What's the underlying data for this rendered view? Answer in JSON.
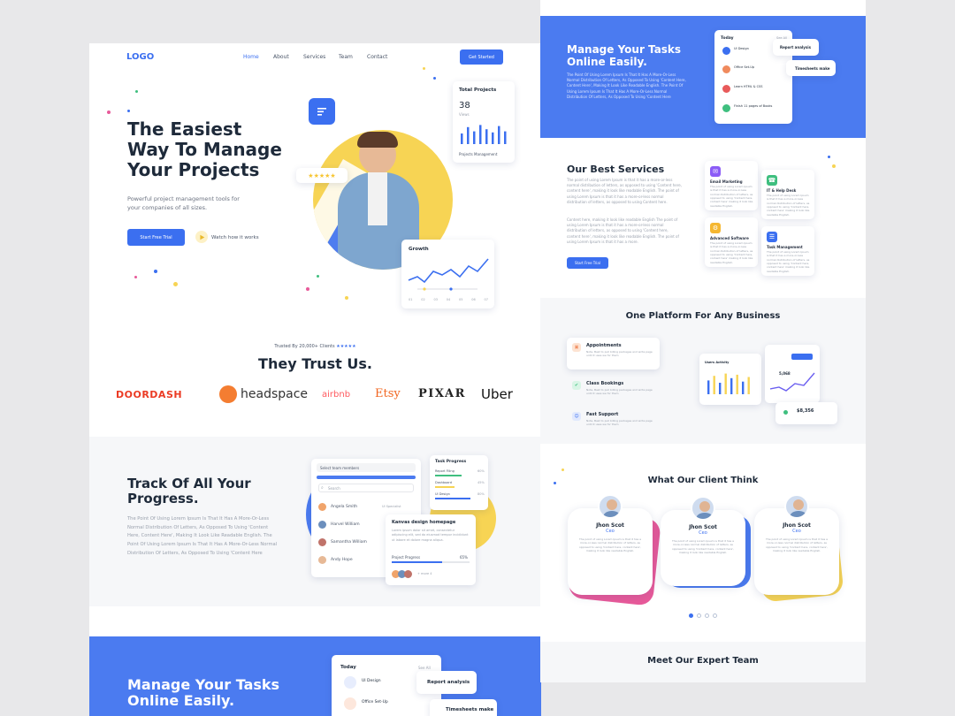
{
  "left": {
    "logo": "LOGO",
    "nav": [
      "Home",
      "About",
      "Services",
      "Team",
      "Contact"
    ],
    "cta": "Get Started",
    "hero": {
      "title_lines": [
        "The  Easiest",
        "Way To Manage",
        "Your  Projects"
      ],
      "subtitle_lines": [
        "Powerful project management tools for",
        "your companies of all sizes."
      ],
      "primary_btn": "Start Free Trial",
      "secondary_btn": "Watch how it works",
      "stars": "★★★★★"
    },
    "total_projects": {
      "title": "Total Projects",
      "value": "38",
      "label": "Views",
      "footer": "Projects Management",
      "bars": [
        0.5,
        0.8,
        0.6,
        0.9,
        0.7,
        0.55,
        0.85,
        0.6
      ]
    },
    "growth": {
      "title": "Growth",
      "axis": [
        "01",
        "02",
        "03",
        "04",
        "05",
        "06",
        "07"
      ]
    },
    "trust": {
      "caption": "Trusted By 20,000+ Clients",
      "stars": "★★★★★",
      "title": "They Trust Us."
    },
    "brands": [
      "DOORDASH",
      "headspace",
      "airbnb",
      "Etsy",
      "PIXAR",
      "Uber"
    ],
    "progress": {
      "title_lines": [
        "Track Of All Your",
        "Progress."
      ],
      "body": "The Point Of Using Lorem Ipsum Is That It Has A More-Or-Less Normal Distribution Of Letters, As Opposed To Using 'Content Here, Content Here', Making It Look Like Readable English. The Point Of Using Lorem Ipsum Is That It Has A More-Or-Less Normal Distribution Of Letters, As Opposed To Using 'Content Here",
      "select_label": "Select team members",
      "search": "Search",
      "members": [
        "Angela Smith",
        "Harvel William",
        "Samantha William",
        "Andy Hope"
      ],
      "member_role": "UI Specialist",
      "task_progress": "Task Progress",
      "task_rows": [
        "Report Filing",
        "Dashboard",
        "UI Design"
      ],
      "task_pcts": [
        "60%",
        "45%",
        "80%"
      ],
      "task_card_title": "Kanvas design homepage",
      "task_card_sub": "Project Progress",
      "task_pct": "65%",
      "members_more": "+ more 4"
    },
    "bottom": {
      "title_lines": [
        "Manage Your Tasks",
        "Online Easily."
      ],
      "today": "Today",
      "see_all": "See All",
      "items": [
        "UI Design",
        "Office Set-Up"
      ],
      "chips": [
        "Report analysis",
        "Timesheets make"
      ]
    }
  },
  "right": {
    "manage": {
      "title_lines": [
        "Manage Your Tasks",
        "Online Easily."
      ],
      "body": "The Point Of Using Lorem Ipsum Is That It Has A More-Or-Less Normal Distribution Of Letters, As Opposed To Using 'Content Here, Content Here', Making It Look Like Readable English. The Point Of Using Lorem Ipsum Is That It Has A More-Or-Less Normal Distribution Of Letters, As Opposed To Using 'Content Here",
      "today": "Today",
      "see_all": "See All",
      "items": [
        "UI Design",
        "Office Set-Up",
        "Learn HTML & CSS",
        "Finish 11 pages of Books"
      ],
      "chips": [
        "Report analysis",
        "Timesheets make"
      ]
    },
    "services": {
      "title": "Our Best Services",
      "body1": "The point of using Lorem Ipsum is that it has a more-or-less normal distribution of letters, as opposed to using 'Content here, content here', making it look like readable English. The point of using Lorem Ipsum is that it has a more-or-less normal distribution of letters, as opposed to using Content here.",
      "body2": "Content here, making it look like readable English The point of using Lorem Ipsum is that it has a more-or-less normal distribution of letters, as opposed to using 'Content here, content here', making it look like readable English. The point of using Lorem Ipsum is that it has a more.",
      "btn": "Start Free Trial",
      "cards": [
        "Email Marketing",
        "IT & Help Desk",
        "Advanced Software",
        "Task Management"
      ],
      "card_text": "The point of using Lorem Ipsum is that it has a more-or-less normal distribution of letters, as opposed to using 'Content here, content here' making it look like readable English."
    },
    "platform": {
      "title": "One Platform For Any Business",
      "features": [
        "Appointments",
        "Class Bookings",
        "Fast Support"
      ],
      "feature_text": "Note, Best to pull billing packages and write page until it uses we for them",
      "users_activity": "Users Activity",
      "stat1": "5,068",
      "stat2": "$8,356"
    },
    "clients": {
      "title": "What Our Client Think",
      "cards": [
        {
          "name": "Jhon Scot",
          "role": "Ceo"
        },
        {
          "name": "Jhon Scot",
          "role": "Ceo"
        },
        {
          "name": "Jhon Scot",
          "role": "Ceo"
        }
      ],
      "quote": "The point of using Lorem Ipsum is that it has a more-or-less normal distribution of letters, as opposed to using 'Content here, content here', making it look like readable English."
    },
    "team": {
      "title": "Meet Our Expert Team"
    }
  },
  "colors": {
    "primary": "#3b6ff0",
    "band": "#4b7bf0",
    "yellow": "#f7d454",
    "pink": "#e85a9a",
    "dark": "#1e2a3a"
  },
  "icons": [
    "play-icon",
    "star-icon",
    "search-icon",
    "check-icon",
    "chevron-down-icon"
  ]
}
